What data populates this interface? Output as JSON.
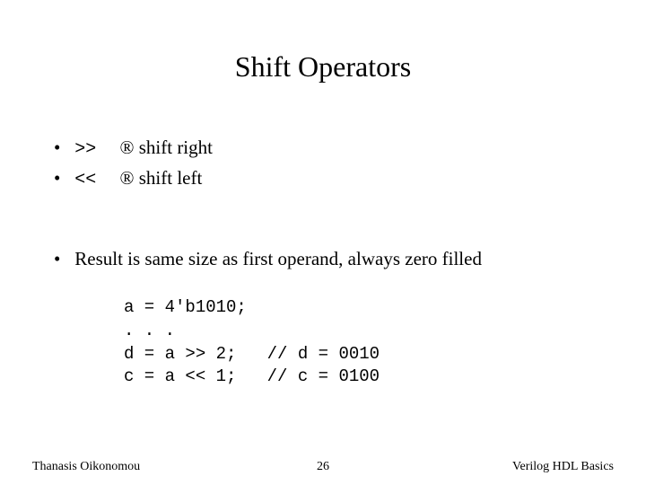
{
  "title": "Shift Operators",
  "bullets": {
    "b1_op": ">>",
    "b1_arrow": "®",
    "b1_text": " shift right",
    "b2_op": "<<",
    "b2_arrow": "®",
    "b2_text": " shift left",
    "b3_text": "Result is same size as first operand, always zero filled"
  },
  "code": {
    "l1": "a = 4'b1010;",
    "l2": ". . .",
    "l3": "d = a >> 2;   // d = 0010",
    "l4": "c = a << 1;   // c = 0100"
  },
  "footer": {
    "left": "Thanasis Oikonomou",
    "center": "26",
    "right": "Verilog HDL Basics"
  }
}
